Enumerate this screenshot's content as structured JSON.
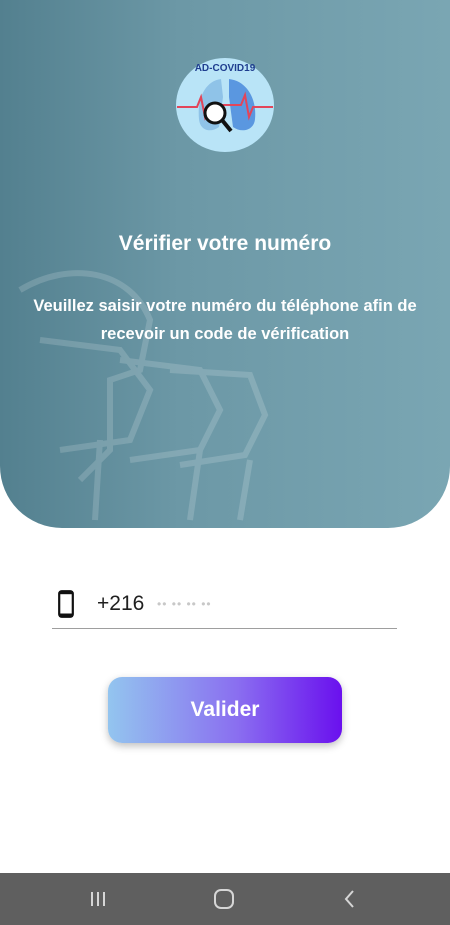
{
  "logo": {
    "text": "AD-COVID19",
    "icon": "lungs-magnifier-logo"
  },
  "header": {
    "title": "Vérifier votre numéro",
    "subtitle": "Veuillez saisir votre numéro du téléphone afin de recevoir un code de vérification"
  },
  "phone": {
    "icon": "smartphone-icon",
    "prefix": "+216",
    "value": "",
    "placeholder": "•• •• •• ••"
  },
  "submit": {
    "label": "Valider"
  },
  "navbar": {
    "recents_icon": "recent-apps-icon",
    "home_icon": "home-icon",
    "back_icon": "back-icon"
  },
  "colors": {
    "hero_start": "#53808f",
    "hero_end": "#7aa6b3",
    "button_start": "#93c5ef",
    "button_end": "#6a10ee",
    "navbar": "#5f5f5f"
  }
}
